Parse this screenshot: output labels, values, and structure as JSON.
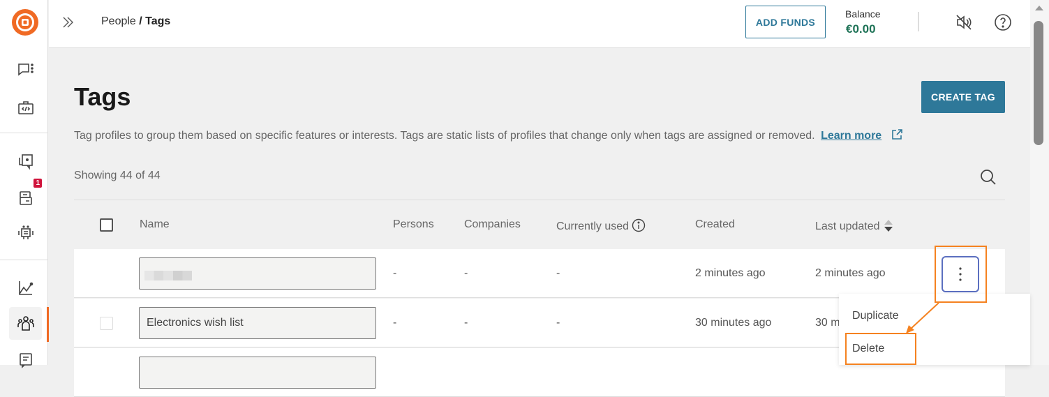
{
  "sidebar": {
    "items": [
      {
        "id": "conversations",
        "icon": "chat-menu-icon"
      },
      {
        "id": "developer",
        "icon": "code-bag-icon"
      },
      {
        "id": "templates",
        "icon": "chat-copy-icon"
      },
      {
        "id": "campaigns",
        "icon": "form-icon",
        "badge": "1"
      },
      {
        "id": "automation",
        "icon": "robot-icon"
      },
      {
        "id": "analytics",
        "icon": "chart-icon"
      },
      {
        "id": "people",
        "icon": "people-icon",
        "active": true
      },
      {
        "id": "notes",
        "icon": "note-icon"
      }
    ],
    "accent": "#f06a24"
  },
  "header": {
    "breadcrumb_parent": "People",
    "breadcrumb_sep": " / ",
    "breadcrumb_current": "Tags",
    "add_funds_label": "ADD FUNDS",
    "balance_label": "Balance",
    "balance_value": "€0.00"
  },
  "page": {
    "title": "Tags",
    "create_button": "CREATE TAG",
    "description": "Tag profiles to group them based on specific features or interests. Tags are static lists of profiles that change only when tags are assigned or removed.",
    "learn_more": "Learn more",
    "showing": "Showing 44 of 44"
  },
  "table": {
    "columns": [
      "Name",
      "Persons",
      "Companies",
      "Currently used",
      "Created",
      "Last updated"
    ],
    "rows": [
      {
        "name": "",
        "name_blurred": true,
        "persons": "-",
        "companies": "-",
        "currently_used": "-",
        "created": "2 minutes ago",
        "last_updated": "2 minutes ago"
      },
      {
        "name": "Electronics wish list",
        "persons": "-",
        "companies": "-",
        "currently_used": "-",
        "created": "30 minutes ago",
        "last_updated": "30 m"
      },
      {
        "name": "",
        "persons": "",
        "companies": "",
        "currently_used": "",
        "created": "",
        "last_updated": ""
      }
    ]
  },
  "context_menu": {
    "items": [
      "Duplicate",
      "Delete"
    ]
  },
  "colors": {
    "primary": "#2e7899",
    "balance": "#1f7357",
    "highlight": "#f58220",
    "badge": "#d0143c"
  }
}
